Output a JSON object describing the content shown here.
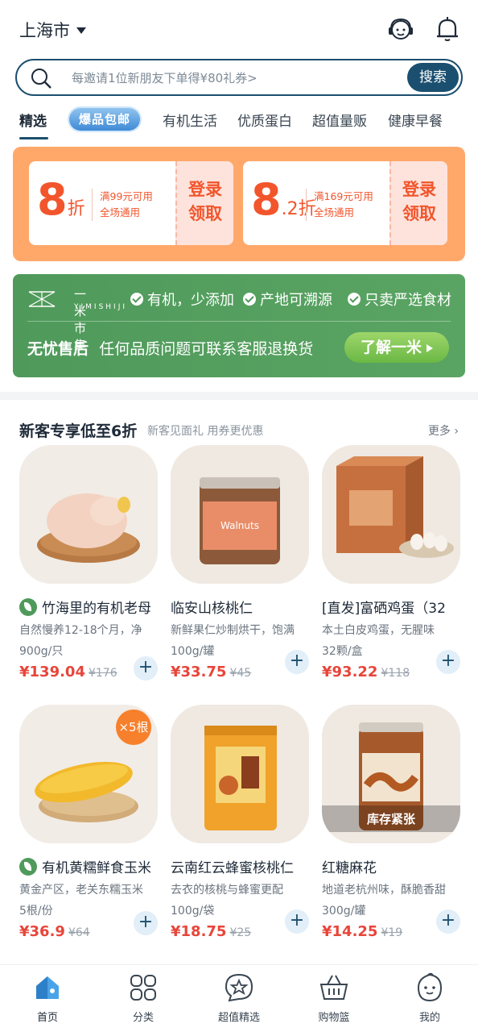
{
  "header": {
    "city": "上海市"
  },
  "search": {
    "placeholder": "每邀请1位新朋友下单得¥80礼券>",
    "button": "搜索"
  },
  "tabs": [
    {
      "label": "精选",
      "active": true
    },
    {
      "label": "爆品包邮",
      "pill": true
    },
    {
      "label": "有机生活"
    },
    {
      "label": "优质蛋白"
    },
    {
      "label": "超值量贩"
    },
    {
      "label": "健康早餐"
    }
  ],
  "coupons": [
    {
      "big": "8",
      "small": "折",
      "cond1": "满99元可用",
      "cond2": "全场通用",
      "claim1": "登录",
      "claim2": "领取"
    },
    {
      "big": "8",
      "decimal": ".2",
      "small": "折",
      "cond1": "满169元可用",
      "cond2": "全场通用",
      "claim1": "登录",
      "claim2": "领取"
    }
  ],
  "brand_banner": {
    "brand_name": "一米市集",
    "brand_en": "YIMISHIJI",
    "features": [
      "有机，少添加",
      "产地可溯源",
      "只卖严选食材"
    ],
    "headline": "无忧售后",
    "headline_desc": "任何品质问题可联系客服退换货",
    "button": "了解一米"
  },
  "section": {
    "title": "新客专享低至6折",
    "subtitle": "新客见面礼 用券更优惠",
    "more": "更多"
  },
  "products": [
    {
      "name": "竹海里的有机老母",
      "organic": true,
      "desc": "自然慢养12-18个月，净",
      "spec": "900g/只",
      "price": "¥139.04",
      "orig": "¥176"
    },
    {
      "name": "临安山核桃仁",
      "organic": false,
      "desc": "新鲜果仁炒制烘干，饱满",
      "spec": "100g/罐",
      "price": "¥33.75",
      "orig": "¥45"
    },
    {
      "name": "[直发]富硒鸡蛋（32",
      "organic": false,
      "desc": "本土白皮鸡蛋，无腥味",
      "spec": "32颗/盒",
      "price": "¥93.22",
      "orig": "¥118"
    },
    {
      "name": "有机黄糯鲜食玉米",
      "organic": true,
      "desc": "黄金产区，老关东糯玉米",
      "spec": "5根/份",
      "price": "¥36.9",
      "orig": "¥64",
      "badge": "×5根"
    },
    {
      "name": "云南红云蜂蜜核桃仁",
      "organic": false,
      "desc": "去衣的核桃与蜂蜜更配",
      "spec": "100g/袋",
      "price": "¥18.75",
      "orig": "¥25"
    },
    {
      "name": "红糖麻花",
      "organic": false,
      "desc": "地道老杭州味，酥脆香甜",
      "spec": "300g/罐",
      "price": "¥14.25",
      "orig": "¥19",
      "stock": "库存紧张"
    }
  ],
  "bottom_nav": [
    {
      "label": "首页",
      "icon": "home-icon",
      "active": true
    },
    {
      "label": "分类",
      "icon": "category-icon"
    },
    {
      "label": "超值精选",
      "icon": "star-bubble-icon"
    },
    {
      "label": "购物篮",
      "icon": "basket-icon"
    },
    {
      "label": "我的",
      "icon": "profile-icon"
    }
  ],
  "colors": {
    "primary": "#1b4f6f",
    "price": "#e8453a",
    "coupon_bg": "#ffa86a",
    "green_banner": "#4f9a5b"
  }
}
